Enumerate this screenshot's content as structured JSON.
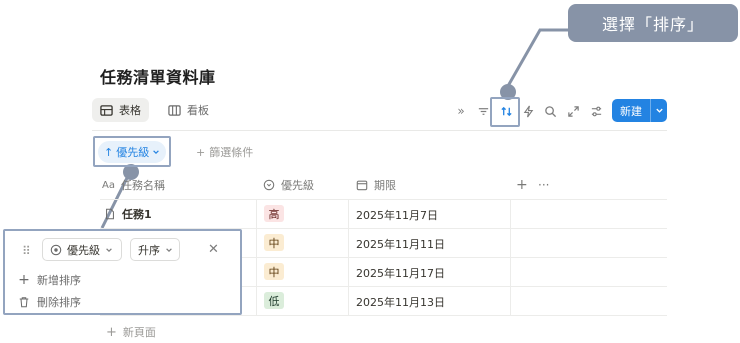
{
  "page": {
    "title": "任務清單資料庫"
  },
  "views": [
    {
      "label": "表格",
      "icon": "table-icon",
      "active": true
    },
    {
      "label": "看板",
      "icon": "board-icon",
      "active": false
    }
  ],
  "toolbar": {
    "icons": [
      "expand-chevrons-icon",
      "filter-icon",
      "sort-icon",
      "automation-icon",
      "search-icon",
      "open-full-icon",
      "settings-sliders-icon"
    ],
    "new_label": "新建"
  },
  "filter_bar": {
    "sort_chip_label": "優先級",
    "add_filter_label": "篩選條件"
  },
  "table": {
    "columns": [
      {
        "label": "任務名稱",
        "icon": "text-aa-icon"
      },
      {
        "label": "優先級",
        "icon": "status-circle-icon"
      },
      {
        "label": "期限",
        "icon": "calendar-icon"
      }
    ],
    "rows": [
      {
        "name": "任務1",
        "priority": "高",
        "due": "2025年11月7日"
      },
      {
        "name": "",
        "priority": "中",
        "due": "2025年11月11日"
      },
      {
        "name": "",
        "priority": "中",
        "due": "2025年11月17日"
      },
      {
        "name": "",
        "priority": "低",
        "due": "2025年11月13日"
      }
    ],
    "new_page_label": "新頁面"
  },
  "sort_popup": {
    "field": "優先級",
    "direction": "升序",
    "add_sort_label": "新增排序",
    "delete_sort_label": "刪除排序"
  },
  "annotation": {
    "callout": "選擇「排序」"
  },
  "colors": {
    "accent": "#2383e2",
    "tag_high_bg": "#fbe4e4",
    "tag_mid_bg": "#fbecd2",
    "tag_low_bg": "#dbeddb",
    "annotation": "#8793a7"
  }
}
